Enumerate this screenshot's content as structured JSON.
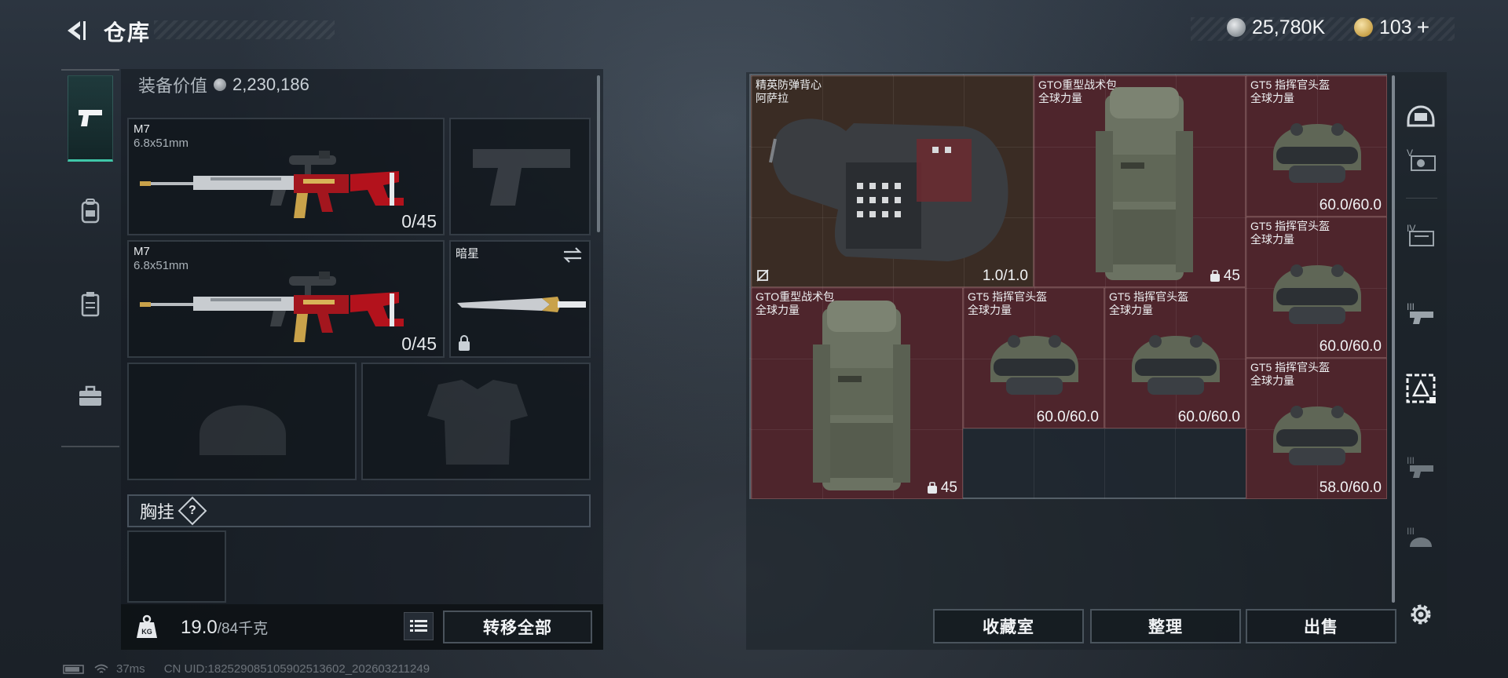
{
  "header": {
    "title": "仓库",
    "currencies": [
      {
        "icon": "silver-coin-icon",
        "value": "25,780K"
      },
      {
        "icon": "gold-triangle-coin-icon",
        "value": "103"
      }
    ]
  },
  "tabs": [
    {
      "icon": "pistol-icon",
      "active": true
    },
    {
      "icon": "backpack-icon",
      "active": false
    },
    {
      "icon": "chest-rig-icon",
      "active": false
    },
    {
      "icon": "briefcase-icon",
      "active": false
    }
  ],
  "loadout": {
    "equip_value_label": "装备价值",
    "equip_value": "2,230,186",
    "primary1": {
      "name": "M7",
      "caliber": "6.8x51mm",
      "ammo": "0/45"
    },
    "primary2": {
      "name": "M7",
      "caliber": "6.8x51mm",
      "ammo": "0/45"
    },
    "melee": {
      "name": "暗星"
    },
    "chest_rig_label": "胸挂",
    "chest_rig_help": "?"
  },
  "weight": {
    "current": "19.0",
    "max": "/84千克"
  },
  "buttons": {
    "transfer_all": "转移全部",
    "collection": "收藏室",
    "sort": "整理",
    "sell": "出售"
  },
  "storage_items": [
    {
      "name1": "精英防弹背心",
      "name2": "阿萨拉",
      "value": "1.0/1.0"
    },
    {
      "name1": "GTO重型战术包",
      "name2": "全球力量",
      "count": "45"
    },
    {
      "name1": "GT5 指挥官头盔",
      "name2": "全球力量",
      "value": "60.0/60.0"
    },
    {
      "name1": "GT5 指挥官头盔",
      "name2": "全球力量",
      "value": "60.0/60.0"
    },
    {
      "name1": "GTO重型战术包",
      "name2": "全球力量",
      "count": "45"
    },
    {
      "name1": "GT5 指挥官头盔",
      "name2": "全球力量",
      "value": "60.0/60.0"
    },
    {
      "name1": "GT5 指挥官头盔",
      "name2": "全球力量",
      "value": "60.0/60.0"
    },
    {
      "name1": "GT5 指挥官头盔",
      "name2": "全球力量",
      "value": "58.0/60.0"
    }
  ],
  "side_filters": [
    "helmet-filter-icon",
    "tier-v-icon",
    "tier-iv-icon",
    "tier-iii-icon",
    "tier-ii-selected-icon",
    "tier-iii-icon",
    "tier-iii-icon"
  ],
  "status": {
    "ping": "37ms",
    "uid": "CN UID:18252908510590251360​2_202603211249"
  }
}
